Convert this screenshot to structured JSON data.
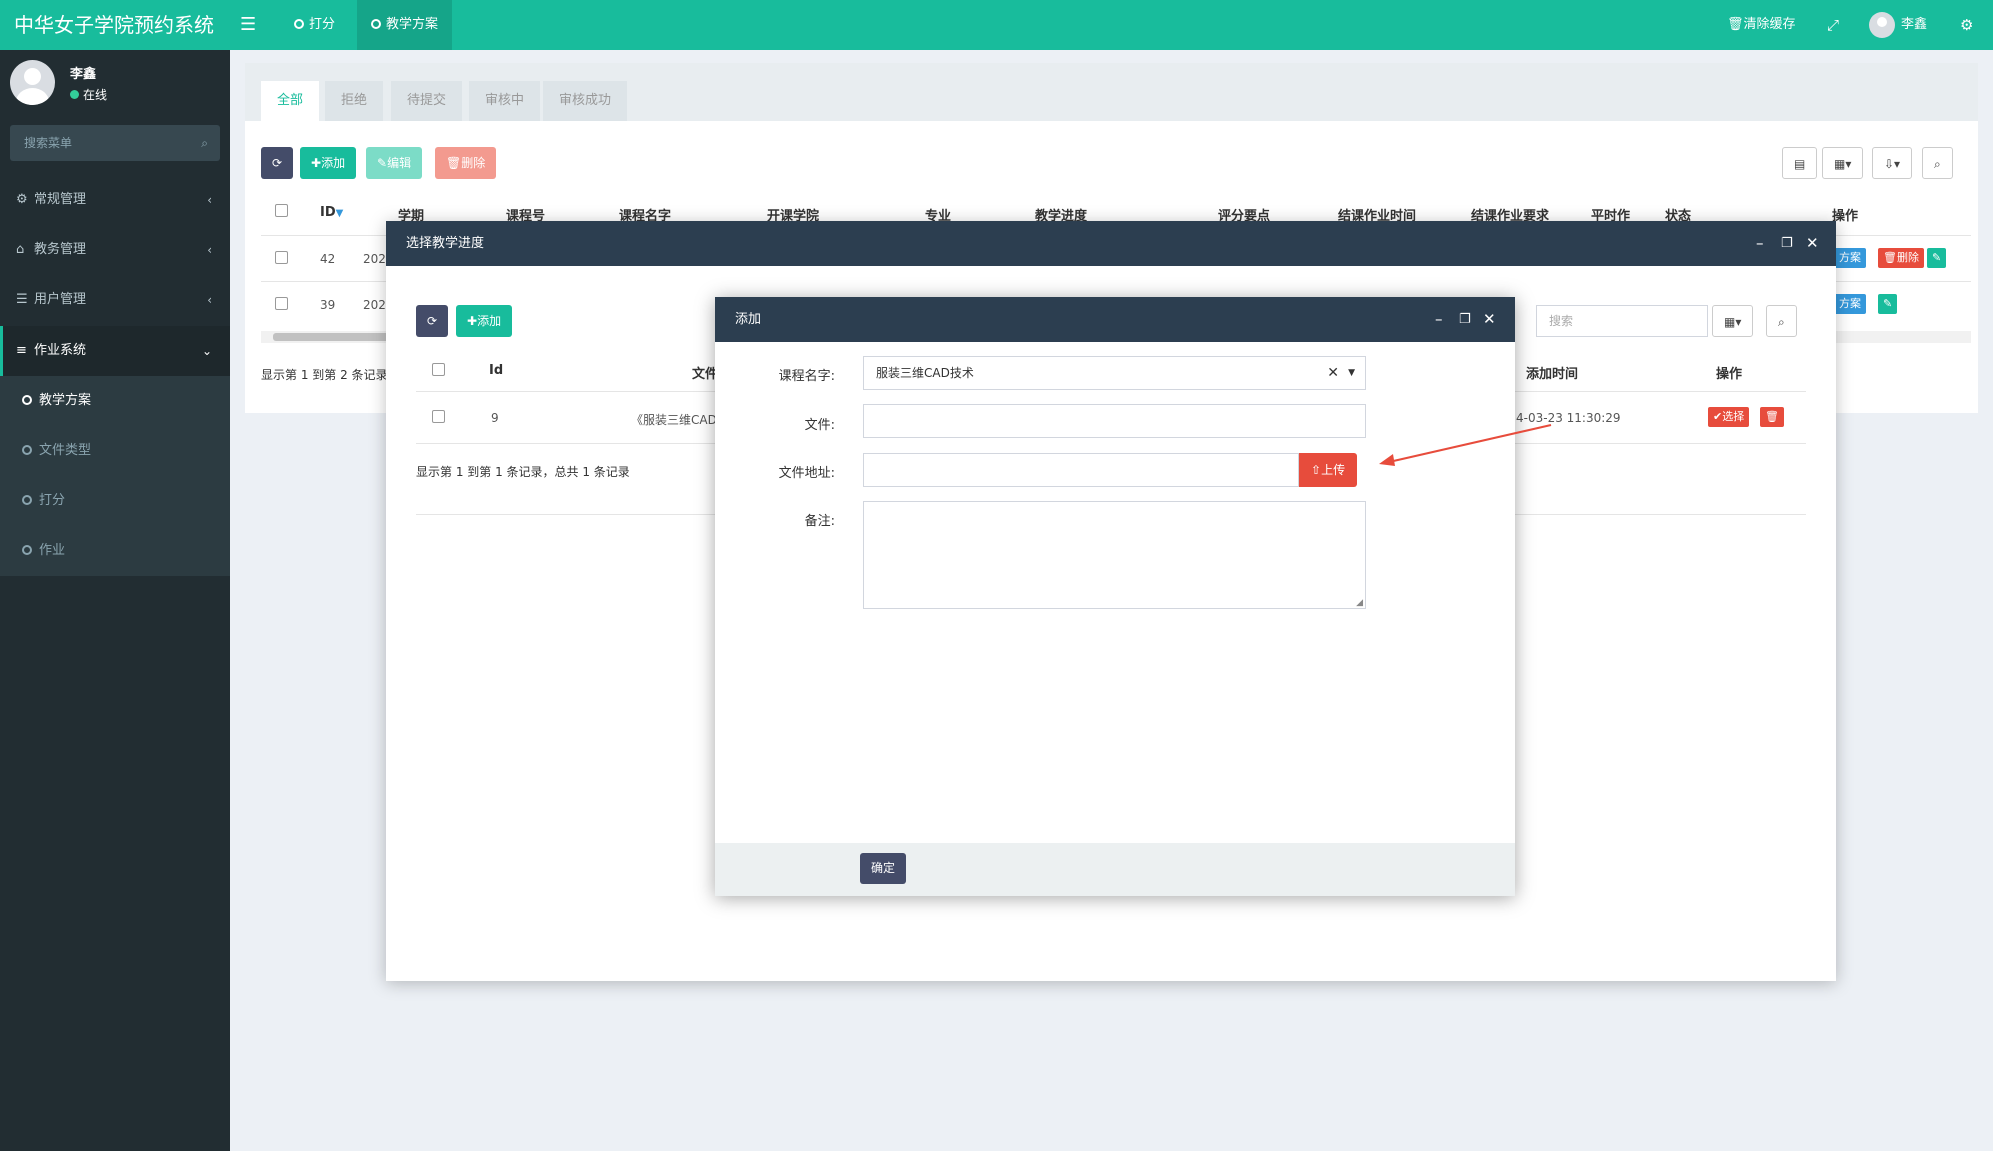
{
  "header": {
    "brand": "中华女子学院预约系统",
    "tabs": [
      {
        "label": "打分"
      },
      {
        "label": "教学方案"
      }
    ],
    "clear_cache": "清除缓存",
    "username": "李鑫"
  },
  "sidebar": {
    "user": {
      "name": "李鑫",
      "status": "在线"
    },
    "search_placeholder": "搜索菜单",
    "menu": [
      {
        "label": "常规管理"
      },
      {
        "label": "教务管理"
      },
      {
        "label": "用户管理"
      },
      {
        "label": "作业系统"
      }
    ],
    "submenu": [
      {
        "label": "教学方案"
      },
      {
        "label": "文件类型"
      },
      {
        "label": "打分"
      },
      {
        "label": "作业"
      }
    ]
  },
  "content": {
    "tabs": [
      {
        "label": "全部"
      },
      {
        "label": "拒绝"
      },
      {
        "label": "待提交"
      },
      {
        "label": "审核中"
      },
      {
        "label": "审核成功"
      }
    ],
    "toolbar": {
      "add": "添加",
      "edit": "编辑",
      "delete": "删除"
    },
    "columns": [
      "ID",
      "学期",
      "课程号",
      "课程名字",
      "开课学院",
      "专业",
      "教学进度",
      "评分要点",
      "结课作业时间",
      "结课作业要求",
      "平时作",
      "状态",
      "操作"
    ],
    "rows": [
      {
        "id": "42",
        "term": "202"
      },
      {
        "id": "39",
        "term": "202"
      }
    ],
    "row_actions": {
      "plan": "方案",
      "delete": "删除"
    },
    "footer": "显示第 1 到第 2 条记录"
  },
  "modal_outer": {
    "title": "选择教学进度",
    "add": "添加",
    "search_placeholder": "搜索",
    "columns": [
      "Id",
      "文件",
      "添加时间",
      "操作"
    ],
    "row": {
      "id": "9",
      "file": "《服装三维CAD",
      "time": "4-03-23 11:30:29",
      "select": "选择"
    },
    "footer": "显示第 1 到第 1 条记录，总共 1 条记录"
  },
  "modal_inner": {
    "title": "添加",
    "fields": {
      "course_label": "课程名字:",
      "course_value": "服装三维CAD技术",
      "file_label": "文件:",
      "file_value": "",
      "addr_label": "文件地址:",
      "addr_value": "",
      "upload": "上传",
      "remark_label": "备注:",
      "remark_value": ""
    },
    "confirm": "确定"
  },
  "colors": {
    "primary": "#18bc9c",
    "dark": "#2c3e50",
    "danger": "#e74c3c",
    "info": "#3498db",
    "sidebar": "#222d32"
  }
}
